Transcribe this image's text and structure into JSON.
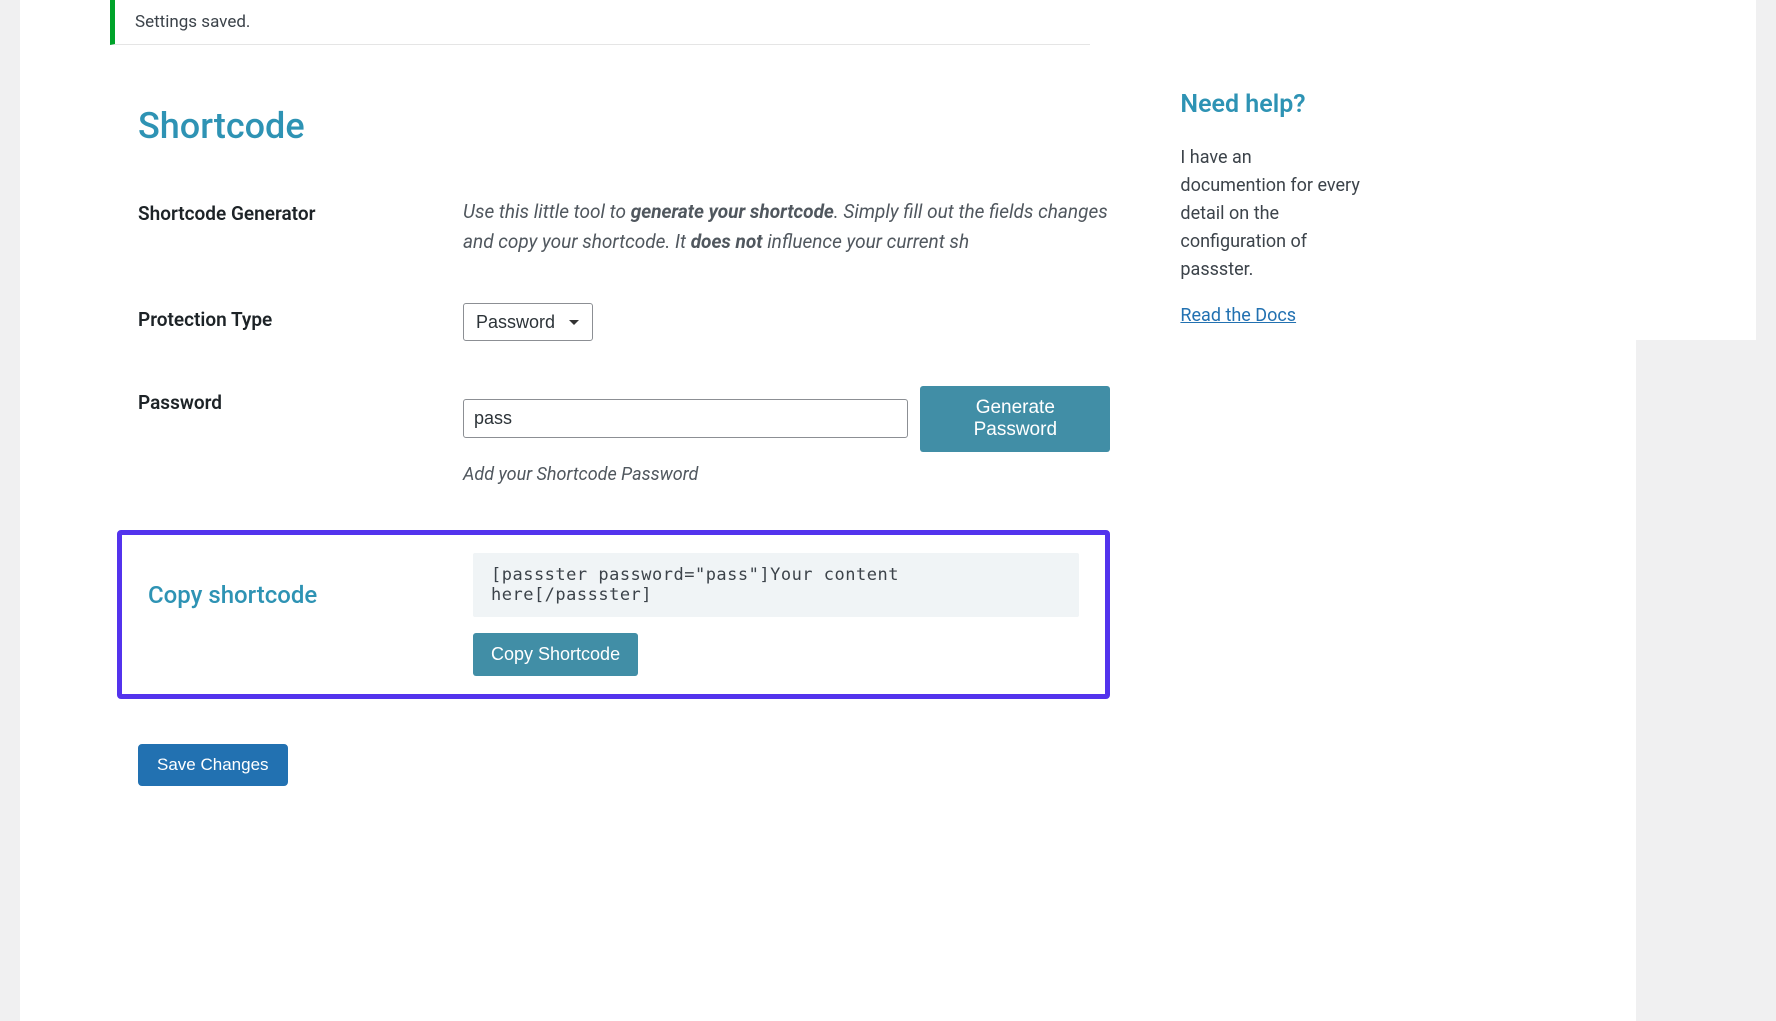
{
  "notice": {
    "message": "Settings saved."
  },
  "section": {
    "title": "Shortcode"
  },
  "generator": {
    "label": "Shortcode Generator",
    "desc_part1": "Use this little tool to ",
    "desc_bold1": "generate your shortcode",
    "desc_part2": ". Simply fill out the fields changes and copy your shortcode. It ",
    "desc_bold2": "does not",
    "desc_part3": " influence your current sh"
  },
  "protection": {
    "label": "Protection Type",
    "selected": "Password"
  },
  "password": {
    "label": "Password",
    "value": "pass",
    "generate_button": "Generate Password",
    "helper": "Add your Shortcode Password"
  },
  "copy": {
    "label": "Copy shortcode",
    "shortcode": "[passster password=\"pass\"]Your content here[/passster]",
    "button": "Copy Shortcode"
  },
  "save": {
    "button": "Save Changes"
  },
  "sidebar": {
    "title": "Need help?",
    "text": "I have an documention for every detail on the configuration of passster.",
    "link": "Read the Docs"
  }
}
